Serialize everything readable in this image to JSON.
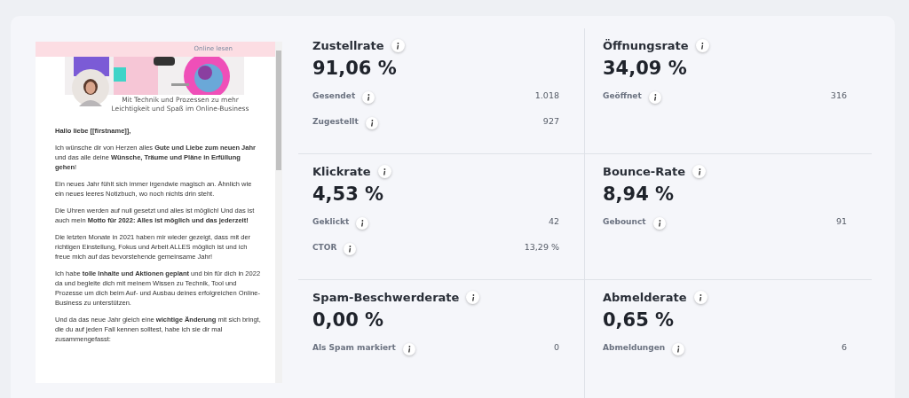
{
  "email_preview": {
    "header_link": "Online lesen",
    "tagline": "Mit Technik und Prozessen zu mehr Leichtigkeit und Spaß im Online-Business",
    "paragraphs": [
      "**Hallo liebe [[firstname]],**",
      "Ich wünsche dir von Herzen alles **Gute und Liebe zum neuen Jahr** und das alle deine **Wünsche, Träume und Pläne in Erfüllung gehen**!",
      "Ein neues Jahr fühlt sich immer irgendwie magisch an. Ähnlich wie ein neues leeres Notizbuch, wo noch nichts drin steht.",
      "Die Uhren werden auf null gesetzt und alles ist möglich! Und das ist auch mein **Motto für 2022: Alles ist möglich und das jederzeit!**",
      "Die letzten Monate in 2021 haben mir wieder gezeigt, dass mit der richtigen Einstellung, Fokus und Arbeit ALLES möglich ist und ich freue mich auf das bevorstehende gemeinsame Jahr!",
      "Ich habe **tolle Inhalte und Aktionen geplant** und bin für dich in 2022 da und begleite dich mit meinem Wissen zu Technik, Tool und Prozesse um dich beim Auf- und Ausbau deines erfolgreichen Online-Business zu unterstützen.",
      "Und da das neue Jahr gleich eine **wichtige Änderung** mit sich bringt, die du auf jeden Fall kennen solltest, habe ich sie dir mal zusammengefasst:"
    ]
  },
  "metrics": [
    {
      "title": "Zustellrate",
      "value": "91,06 %",
      "rows": [
        {
          "label": "Gesendet",
          "value": "1.018"
        },
        {
          "label": "Zugestellt",
          "value": "927"
        }
      ]
    },
    {
      "title": "Öffnungsrate",
      "value": "34,09 %",
      "rows": [
        {
          "label": "Geöffnet",
          "value": "316"
        }
      ]
    },
    {
      "title": "Klickrate",
      "value": "4,53 %",
      "rows": [
        {
          "label": "Geklickt",
          "value": "42"
        },
        {
          "label": "CTOR",
          "value": "13,29 %"
        }
      ]
    },
    {
      "title": "Bounce-Rate",
      "value": "8,94 %",
      "rows": [
        {
          "label": "Gebounct",
          "value": "91"
        }
      ]
    },
    {
      "title": "Spam-Beschwerderate",
      "value": "0,00 %",
      "rows": [
        {
          "label": "Als Spam markiert",
          "value": "0"
        }
      ]
    },
    {
      "title": "Abmelderate",
      "value": "0,65 %",
      "rows": [
        {
          "label": "Abmeldungen",
          "value": "6"
        }
      ]
    }
  ]
}
